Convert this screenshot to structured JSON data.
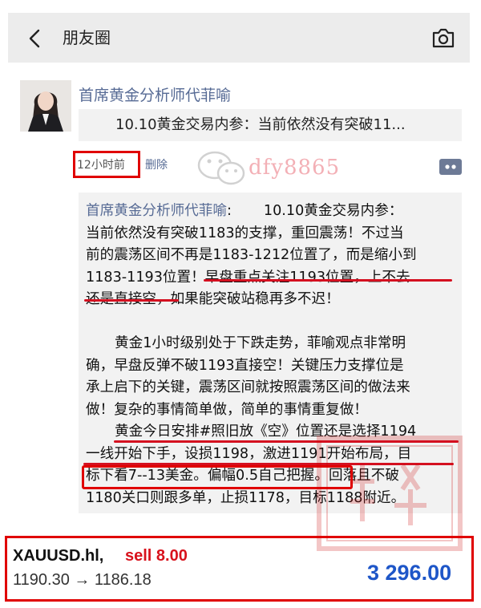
{
  "header": {
    "title": "朋友圈",
    "back_icon": "chevron-left-icon",
    "camera_icon": "camera-icon"
  },
  "post": {
    "author": "首席黄金分析师代菲喻",
    "shared_article_title": "10.10黄金交易内参：当前依然没有突破11...",
    "time": "12小时前",
    "delete_label": "删除",
    "watermark": "dfy8865",
    "comment_button_icon": "more-dots-icon"
  },
  "comment": {
    "author": "首席黄金分析师代菲喻",
    "separator": ":",
    "p1": {
      "line1_rest": "10.10黄金交易内参：",
      "line2": "当前依然没有突破1183的支撑，重回震荡！不过当",
      "line3": "前的震荡区间不再是1183-1212位置了，而是缩小到",
      "line4": "1183-1193位置！早盘重点关注1193位置，上不去",
      "line5": "还是直接空，如果能突破站稳再多不迟！"
    },
    "p2": {
      "line1": "黄金1小时级别处于下跌走势，菲喻观点非常明",
      "line2": "确，早盘反弹不破1193直接空！关键压力支撑位是",
      "line3": "承上启下的关键，震荡区间就按照震荡区间的做法来",
      "line4": "做！复杂的事情简单做，简单的事情重复做！"
    },
    "p3": {
      "line1": "黄金今日安排#照旧放《空》位置还是选择1194",
      "line2": "一线开始下手，设损1198，激进1191开始布局，目",
      "line3": "标下看7--13美金。偏幅0.5自己把握。回落且不破",
      "line4": "1180关口则跟多单，止损1178，目标1188附近。"
    }
  },
  "ticker": {
    "symbol": "XAUUSD.hl,",
    "trade": "sell 8.00",
    "prices": "1190.30 → 1186.18",
    "profit": "3 296.00"
  },
  "colors": {
    "link": "#576b95",
    "highlight": "#e00000",
    "sell": "#d8121c",
    "profit": "#1e56c8"
  }
}
